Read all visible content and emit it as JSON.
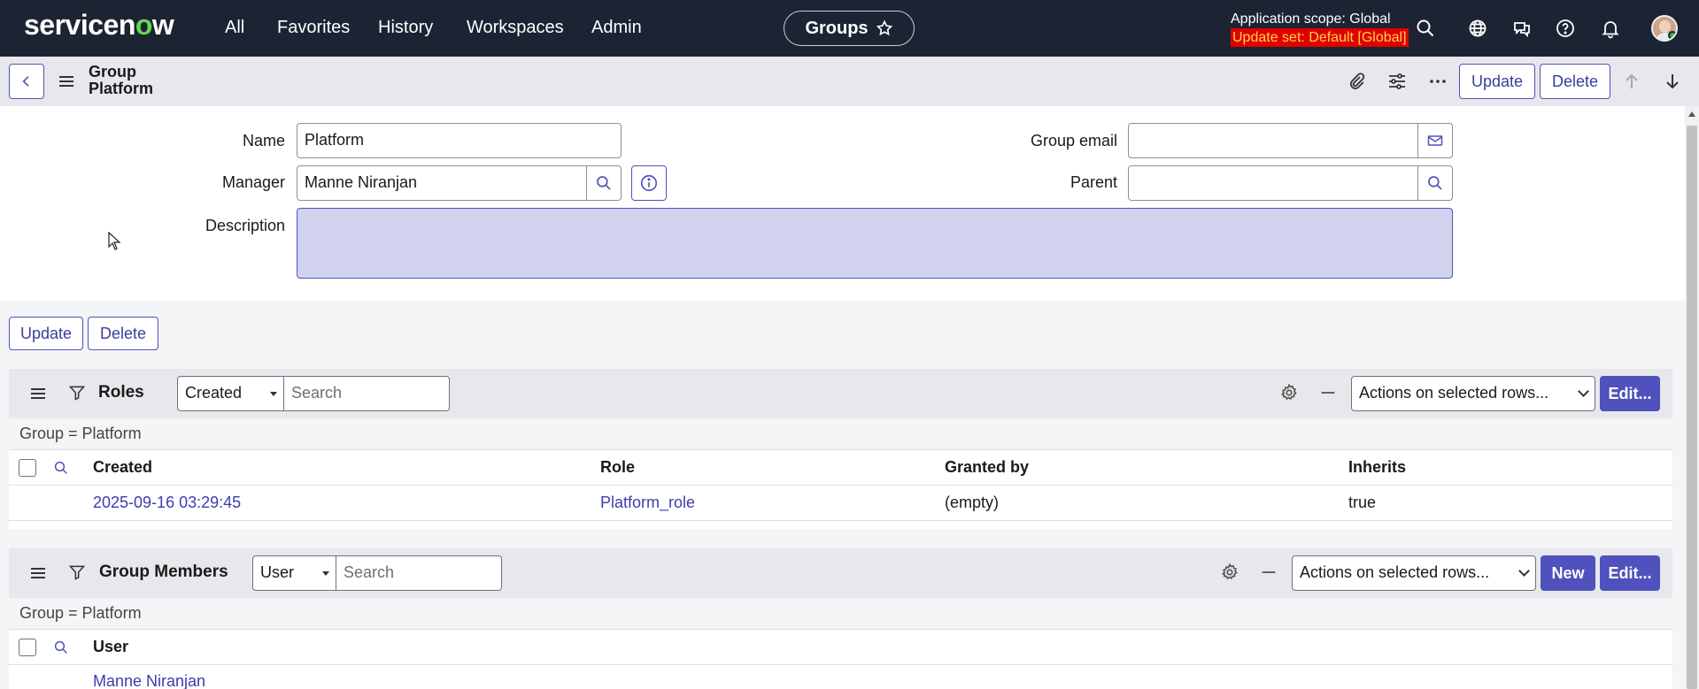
{
  "topnav": {
    "logo": "servicenow",
    "items": [
      "All",
      "Favorites",
      "History",
      "Workspaces",
      "Admin"
    ],
    "context_title": "Groups",
    "scope_label": "Application scope: Global",
    "update_set_label": "Update set: Default [Global]",
    "icons": [
      "search-icon",
      "globe-icon",
      "chat-icon",
      "help-icon",
      "bell-icon",
      "avatar"
    ]
  },
  "form_header": {
    "title_line1": "Group",
    "title_line2": "Platform",
    "update_label": "Update",
    "delete_label": "Delete",
    "icons": [
      "back-icon",
      "menu-icon",
      "attachment-icon",
      "settings-sliders-icon",
      "more-icon",
      "arrow-up-icon",
      "arrow-down-icon"
    ]
  },
  "form": {
    "name_label": "Name",
    "name_value": "Platform",
    "manager_label": "Manager",
    "manager_value": "Manne Niranjan",
    "description_label": "Description",
    "description_value": "",
    "group_email_label": "Group email",
    "group_email_value": "",
    "parent_label": "Parent",
    "parent_value": ""
  },
  "form_actions": {
    "update_label": "Update",
    "delete_label": "Delete"
  },
  "roles_list": {
    "title": "Roles",
    "filter_field": "Created",
    "search_placeholder": "Search",
    "actions_select": "Actions on selected rows...",
    "edit_label": "Edit...",
    "breadcrumb": "Group = Platform",
    "columns": [
      "Created",
      "Role",
      "Granted by",
      "Inherits"
    ],
    "rows": [
      {
        "created": "2025-09-16 03:29:45",
        "role": "Platform_role",
        "granted_by": "(empty)",
        "inherits": "true"
      }
    ]
  },
  "members_list": {
    "title": "Group Members",
    "filter_field": "User",
    "search_placeholder": "Search",
    "actions_select": "Actions on selected rows...",
    "new_label": "New",
    "edit_label": "Edit...",
    "breadcrumb": "Group = Platform",
    "columns": [
      "User"
    ],
    "rows": [
      {
        "user": "Manne Niranjan"
      }
    ]
  },
  "colors": {
    "nav_bg": "#1c2434",
    "accent": "#4f52bd",
    "logo_green": "#62d84e",
    "update_set_bg": "#e00000",
    "update_set_text": "#ffd64a",
    "description_bg": "#d1d2ee"
  }
}
